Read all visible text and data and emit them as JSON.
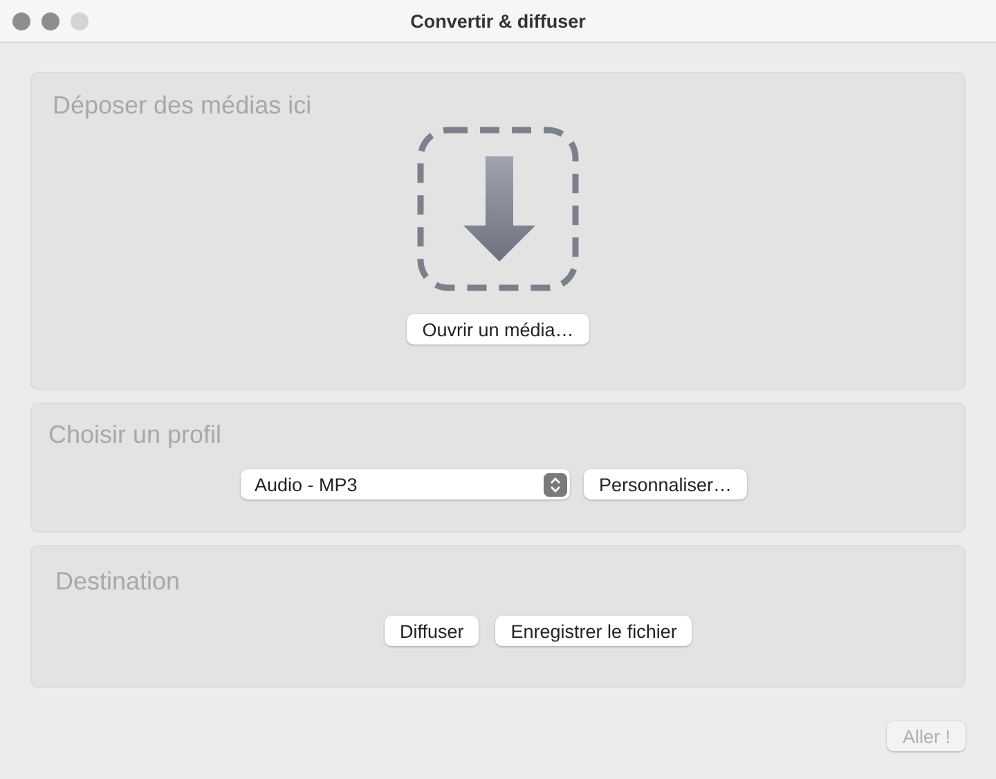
{
  "window": {
    "title": "Convertir & diffuser"
  },
  "drop_panel": {
    "title": "Déposer des médias ici",
    "button": "Ouvrir un média…"
  },
  "profile_panel": {
    "title": "Choisir un profil",
    "select_value": "Audio - MP3",
    "button": "Personnaliser…"
  },
  "destination_panel": {
    "title": "Destination",
    "buttons": [
      "Diffuser",
      "Enregistrer le fichier"
    ]
  },
  "go_button": {
    "label": "Aller !",
    "disabled": true
  }
}
